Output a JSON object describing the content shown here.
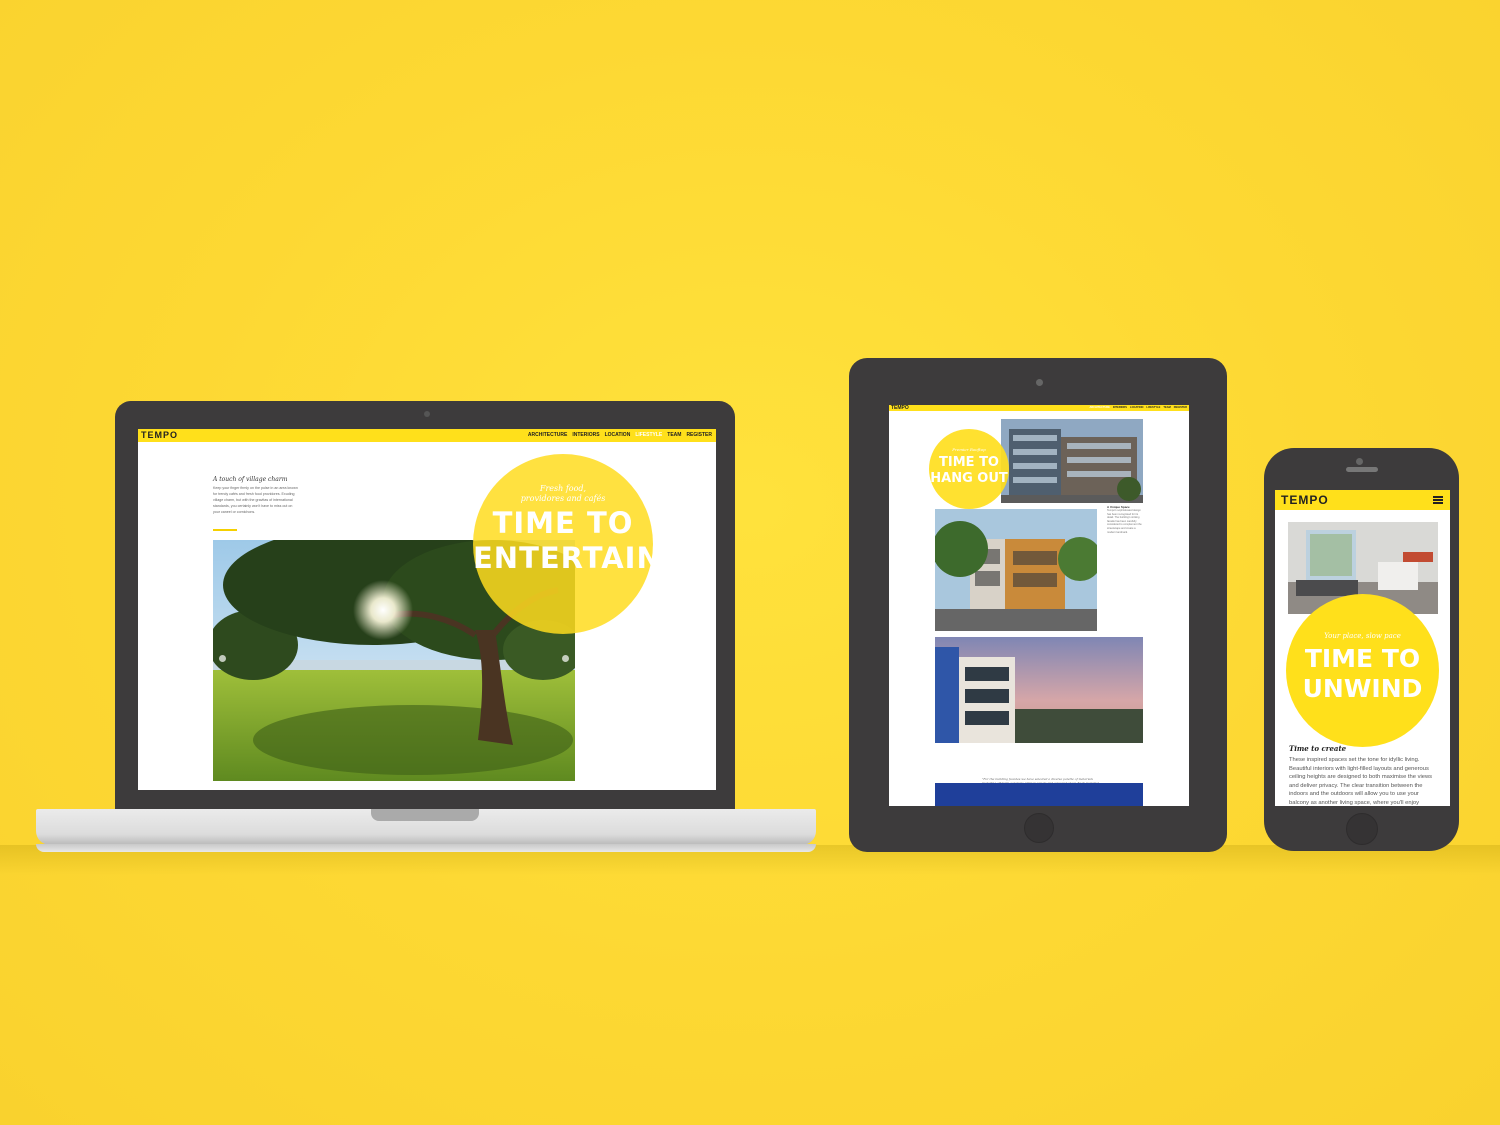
{
  "brand": "TEMPO",
  "laptop": {
    "nav": [
      "ARCHITECTURE",
      "INTERIORS",
      "LOCATION",
      "LIFESTYLE",
      "TEAM",
      "REGISTER"
    ],
    "active_index": 3,
    "subheading": "A touch of village charm",
    "body": "Keep your finger firmly on the pulse in an area known for trendy cafés and fresh food providores. Exuding village charm, but with the gravitas of international standards, you certainly won't have to miss out on your caneel or cornichons.",
    "tagline_1": "Fresh food,",
    "tagline_2": "providores and cafés",
    "headline_1": "TIME TO",
    "headline_2": "ENTERTAIN"
  },
  "tablet": {
    "nav": [
      "ARCHITECTURE",
      "INTERIORS",
      "LOCATION",
      "LIFESTYLE",
      "TEAM",
      "REGISTER"
    ],
    "active_index": 0,
    "tagline": "Premier Rooftop",
    "headline_1": "TIME TO",
    "headline_2": "HANG OUT",
    "side_heading": "A Unique Space",
    "side_text": "Tempo's sophisticated design has been recognised for its detail. The building's striking facade has been carefully considered to complement the streetscape and create a modern landmark.",
    "quote": "\"For the building facades we have selected a diverse palette of materials including off form concrete, timber panels and coloured steel. Each material has been crafted to play with light and shadow to create a unique and compelling built form.\""
  },
  "phone": {
    "tagline": "Your place, slow pace",
    "headline_1": "TIME TO",
    "headline_2": "UNWIND",
    "subheading": "Time to create",
    "body": "These inspired spaces set the tone for idyllic living. Beautiful interiors with light-filled layouts and generous ceiling heights are designed to both maximise the views and deliver privacy. The clear transition between the indoors and the outdoors will allow you to use your balcony as another living space, where you'll enjoy"
  },
  "colors": {
    "background": "#fdd833",
    "accent": "#ffe01b",
    "device": "#3d3b3c"
  },
  "icons": [
    "menu-icon",
    "arrow-left-icon",
    "arrow-right-icon",
    "camera-icon",
    "home-button-icon"
  ]
}
